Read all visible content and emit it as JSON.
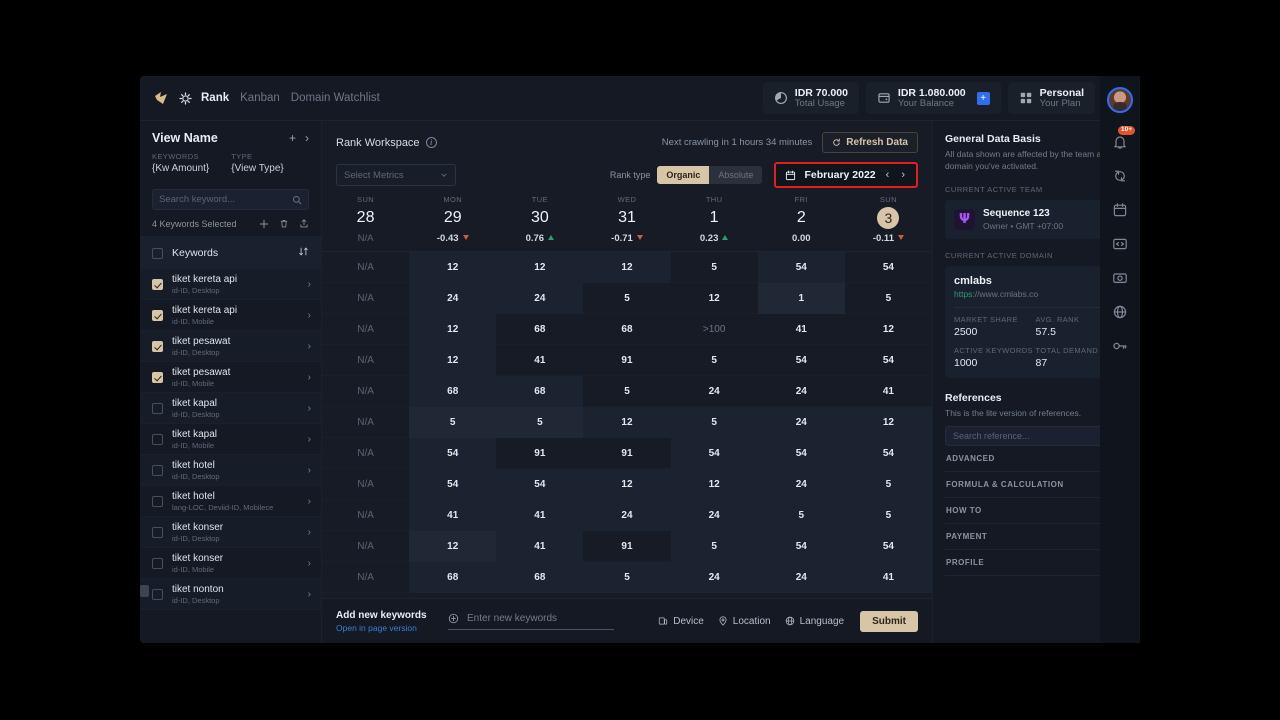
{
  "topbar": {
    "logo_icon": "leaf-logo-icon",
    "gear_icon": "gear-icon",
    "tabs": [
      {
        "label": "Rank",
        "active": true
      },
      {
        "label": "Kanban",
        "active": false
      },
      {
        "label": "Domain Watchlist",
        "active": false
      }
    ],
    "stats": [
      {
        "icon": "pie-chart-icon",
        "value": "IDR 70.000",
        "label": "Total Usage"
      },
      {
        "icon": "wallet-icon",
        "value": "IDR 1.080.000",
        "label": "Your Balance",
        "plus": "+"
      },
      {
        "icon": "grid-icon",
        "value": "Personal",
        "label": "Your Plan"
      }
    ],
    "avatar": "user-avatar"
  },
  "left_panel": {
    "view_name": "View Name",
    "add_icon": "+",
    "expand_icon": "›",
    "meta": [
      {
        "label": "KEYWORDS",
        "value": "{Kw Amount}"
      },
      {
        "label": "TYPE",
        "value": "{View Type}"
      }
    ],
    "search_placeholder": "Search keyword...",
    "search_value": "",
    "selection_text": "4 Keywords Selected",
    "toolbar_icons": [
      "plus-icon",
      "trash-icon",
      "export-icon"
    ],
    "list_header": "Keywords",
    "sort_icon": "sort-icon",
    "keywords": [
      {
        "name": "tiket kereta api",
        "sub": "id-ID, Desktop",
        "checked": true
      },
      {
        "name": "tiket kereta api",
        "sub": "id-ID, Mobile",
        "checked": true
      },
      {
        "name": "tiket pesawat",
        "sub": "id-ID, Desktop",
        "checked": true
      },
      {
        "name": "tiket pesawat",
        "sub": "id-ID, Mobile",
        "checked": true
      },
      {
        "name": "tiket kapal",
        "sub": "id-ID, Desktop",
        "checked": false
      },
      {
        "name": "tiket kapal",
        "sub": "id-ID, Mobile",
        "checked": false
      },
      {
        "name": "tiket hotel",
        "sub": "id-ID, Desktop",
        "checked": false
      },
      {
        "name": "tiket hotel",
        "sub": "lang-LOC, Deviid-ID, Mobilece",
        "checked": false
      },
      {
        "name": "tiket konser",
        "sub": "id-ID, Desktop",
        "checked": false
      },
      {
        "name": "tiket konser",
        "sub": "id-ID, Mobile",
        "checked": false
      },
      {
        "name": "tiket nonton",
        "sub": "id-ID, Desktop",
        "checked": false
      }
    ]
  },
  "workspace": {
    "title": "Rank Workspace",
    "info_icon": "info-icon",
    "crawl_text": "Next crawling in 1 hours 34 minutes",
    "refresh_label": "Refresh Data",
    "refresh_icon": "refresh-icon",
    "metrics_placeholder": "Select Metrics",
    "metrics_chevron": "chevron-down-icon",
    "rank_type_label": "Rank type",
    "rank_type_options": [
      {
        "label": "Organic",
        "selected": true
      },
      {
        "label": "Absolute",
        "selected": false
      }
    ],
    "date_label": "February 2022",
    "date_icon": "calendar-icon",
    "prev_icon": "‹",
    "next_icon": "›",
    "date_highlight_color": "#e02020"
  },
  "table": {
    "columns": [
      {
        "dow": "SUN",
        "day": "28",
        "selected": false,
        "delta": "N/A",
        "dir": "none"
      },
      {
        "dow": "MON",
        "day": "29",
        "selected": false,
        "delta": "-0.43",
        "dir": "down"
      },
      {
        "dow": "TUE",
        "day": "30",
        "selected": false,
        "delta": "0.76",
        "dir": "up"
      },
      {
        "dow": "WED",
        "day": "31",
        "selected": false,
        "delta": "-0.71",
        "dir": "down"
      },
      {
        "dow": "THU",
        "day": "1",
        "selected": false,
        "delta": "0.23",
        "dir": "up"
      },
      {
        "dow": "FRI",
        "day": "2",
        "selected": false,
        "delta": "0.00",
        "dir": "none"
      },
      {
        "dow": "SUN",
        "day": "3",
        "selected": true,
        "delta": "-0.11",
        "dir": "down"
      }
    ],
    "rows": [
      {
        "cells": [
          "N/A",
          "12",
          "12",
          "12",
          "5",
          "54",
          "54"
        ],
        "hl": [
          0,
          1,
          1,
          1,
          0,
          1,
          0
        ]
      },
      {
        "cells": [
          "N/A",
          "24",
          "24",
          "5",
          "12",
          "1",
          "5"
        ],
        "hl": [
          0,
          1,
          1,
          0,
          0,
          2,
          0
        ]
      },
      {
        "cells": [
          "N/A",
          "12",
          "68",
          "68",
          ">100",
          "41",
          "12"
        ],
        "hl": [
          0,
          1,
          0,
          0,
          0,
          0,
          0
        ]
      },
      {
        "cells": [
          "N/A",
          "12",
          "41",
          "91",
          "5",
          "54",
          "54"
        ],
        "hl": [
          0,
          1,
          0,
          0,
          0,
          0,
          0
        ]
      },
      {
        "cells": [
          "N/A",
          "68",
          "68",
          "5",
          "24",
          "24",
          "41"
        ],
        "hl": [
          0,
          1,
          1,
          0,
          0,
          0,
          0
        ]
      },
      {
        "cells": [
          "N/A",
          "5",
          "5",
          "12",
          "5",
          "24",
          "12"
        ],
        "hl": [
          0,
          2,
          2,
          1,
          1,
          1,
          1
        ]
      },
      {
        "cells": [
          "N/A",
          "54",
          "91",
          "91",
          "54",
          "54",
          "54"
        ],
        "hl": [
          0,
          1,
          0,
          0,
          1,
          1,
          1
        ]
      },
      {
        "cells": [
          "N/A",
          "54",
          "54",
          "12",
          "12",
          "24",
          "5"
        ],
        "hl": [
          0,
          1,
          1,
          1,
          1,
          1,
          1
        ]
      },
      {
        "cells": [
          "N/A",
          "41",
          "41",
          "24",
          "24",
          "5",
          "5"
        ],
        "hl": [
          0,
          1,
          1,
          1,
          1,
          1,
          1
        ]
      },
      {
        "cells": [
          "N/A",
          "12",
          "41",
          "91",
          "5",
          "54",
          "54"
        ],
        "hl": [
          0,
          2,
          1,
          0,
          1,
          1,
          1
        ]
      },
      {
        "cells": [
          "N/A",
          "68",
          "68",
          "5",
          "24",
          "24",
          "41"
        ],
        "hl": [
          0,
          1,
          1,
          1,
          1,
          1,
          1
        ]
      }
    ]
  },
  "bottombar": {
    "title": "Add new keywords",
    "subtitle": "Open in page version",
    "input_placeholder": "Enter new keywords",
    "input_value": "",
    "add_icon": "plus-circle-icon",
    "options": [
      {
        "icon": "device-icon",
        "label": "Device"
      },
      {
        "icon": "location-icon",
        "label": "Location"
      },
      {
        "icon": "language-icon",
        "label": "Language"
      }
    ],
    "submit_label": "Submit"
  },
  "right_panel": {
    "heading": "General Data Basis",
    "subheading": "All data shown are affected by the team and domain you've activated.",
    "team_label": "CURRENT ACTIVE TEAM",
    "team_name": "Sequence 123",
    "team_meta": "Owner • GMT +07:00",
    "team_logo_glyph": "Ψ",
    "switch_icon": "switch-icon",
    "domain_label": "CURRENT ACTIVE DOMAIN",
    "domain_name": "cmlabs",
    "domain_url_scheme": "https",
    "domain_url_rest": "://www.cmlabs.co",
    "domain_stats": [
      {
        "label": "MARKET SHARE",
        "value": "2500"
      },
      {
        "label": "AVG. RANK",
        "value": "57.5"
      },
      {
        "label": "ACTIVE KEYWORDS",
        "value": "1000"
      },
      {
        "label": "TOTAL DEMAND",
        "value": "87"
      }
    ],
    "references_heading": "References",
    "references_sub": "This is the lite version of references.",
    "references_search_placeholder": "Search reference...",
    "references_search_value": "",
    "accordions": [
      {
        "label": "ADVANCED"
      },
      {
        "label": "FORMULA & CALCULATION"
      },
      {
        "label": "HOW TO"
      },
      {
        "label": "PAYMENT"
      },
      {
        "label": "PROFILE"
      }
    ]
  },
  "rail": {
    "avatar": "user-avatar",
    "items": [
      {
        "icon": "bell-icon",
        "badge": "10+"
      },
      {
        "icon": "sync-icon",
        "badge": ""
      },
      {
        "icon": "calendar-icon",
        "badge": ""
      },
      {
        "icon": "code-icon",
        "badge": ""
      },
      {
        "icon": "camera-icon",
        "badge": ""
      },
      {
        "icon": "globe-icon",
        "badge": ""
      },
      {
        "icon": "key-icon",
        "badge": ""
      }
    ]
  }
}
